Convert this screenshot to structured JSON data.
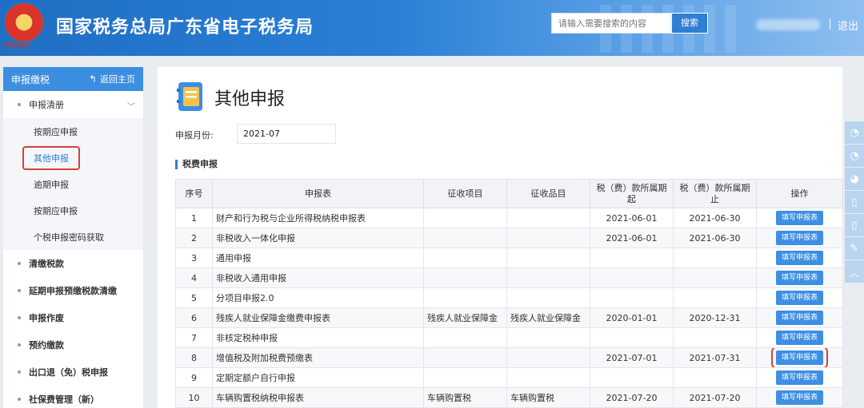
{
  "header": {
    "site_title": "国家税务总局广东省电子税务局",
    "emblem_caption": "中国税务",
    "search_placeholder": "请输入需要搜索的内容",
    "search_button": "搜索",
    "logout": "退出"
  },
  "sidebar": {
    "head_title": "申报缴税",
    "back_label": "返回主页",
    "groups": [
      {
        "label": "申报清册"
      },
      {
        "label": "清缴税款"
      },
      {
        "label": "延期申报预缴税款清缴"
      },
      {
        "label": "申报作废"
      },
      {
        "label": "预约缴款"
      },
      {
        "label": "出口退（免）税申报"
      },
      {
        "label": "社保费管理（新）"
      }
    ],
    "subitems": [
      {
        "label": "按期应申报"
      },
      {
        "label": "其他申报"
      },
      {
        "label": "逾期申报"
      },
      {
        "label": "按期应申报"
      },
      {
        "label": "个税申报密码获取"
      }
    ]
  },
  "main": {
    "page_title": "其他申报",
    "month_label": "申报月份:",
    "month_value": "2021-07",
    "section_title": "税费申报",
    "columns": [
      "序号",
      "申报表",
      "征收项目",
      "征收品目",
      "税（费）款所属期起",
      "税（费）款所属期止",
      "操作"
    ],
    "action_label": "填写申报表",
    "rows": [
      {
        "no": "1",
        "form": "财产和行为税与企业所得税纳税申报表",
        "item": "",
        "sub": "",
        "start": "2021-06-01",
        "end": "2021-06-30"
      },
      {
        "no": "2",
        "form": "非税收入一体化申报",
        "item": "",
        "sub": "",
        "start": "2021-06-01",
        "end": "2021-06-30"
      },
      {
        "no": "3",
        "form": "通用申报",
        "item": "",
        "sub": "",
        "start": "",
        "end": ""
      },
      {
        "no": "4",
        "form": "非税收入通用申报",
        "item": "",
        "sub": "",
        "start": "",
        "end": ""
      },
      {
        "no": "5",
        "form": "分项目申报2.0",
        "item": "",
        "sub": "",
        "start": "",
        "end": ""
      },
      {
        "no": "6",
        "form": "残疾人就业保障金缴费申报表",
        "item": "残疾人就业保障金",
        "sub": "残疾人就业保障金",
        "start": "2020-01-01",
        "end": "2020-12-31"
      },
      {
        "no": "7",
        "form": "非核定税种申报",
        "item": "",
        "sub": "",
        "start": "",
        "end": ""
      },
      {
        "no": "8",
        "form": "增值税及附加税费预缴表",
        "item": "",
        "sub": "",
        "start": "2021-07-01",
        "end": "2021-07-31"
      },
      {
        "no": "9",
        "form": "定期定额户自行申报",
        "item": "",
        "sub": "",
        "start": "",
        "end": ""
      },
      {
        "no": "10",
        "form": "车辆购置税纳税申报表",
        "item": "车辆购置税",
        "sub": "车辆购置税",
        "start": "2021-07-20",
        "end": "2021-07-20"
      }
    ]
  },
  "floatbar": {
    "icons": [
      "chat-icon",
      "chat-icon",
      "weibo-icon",
      "phone-icon",
      "phone-icon",
      "edit-icon",
      "up-arrow-icon"
    ]
  }
}
